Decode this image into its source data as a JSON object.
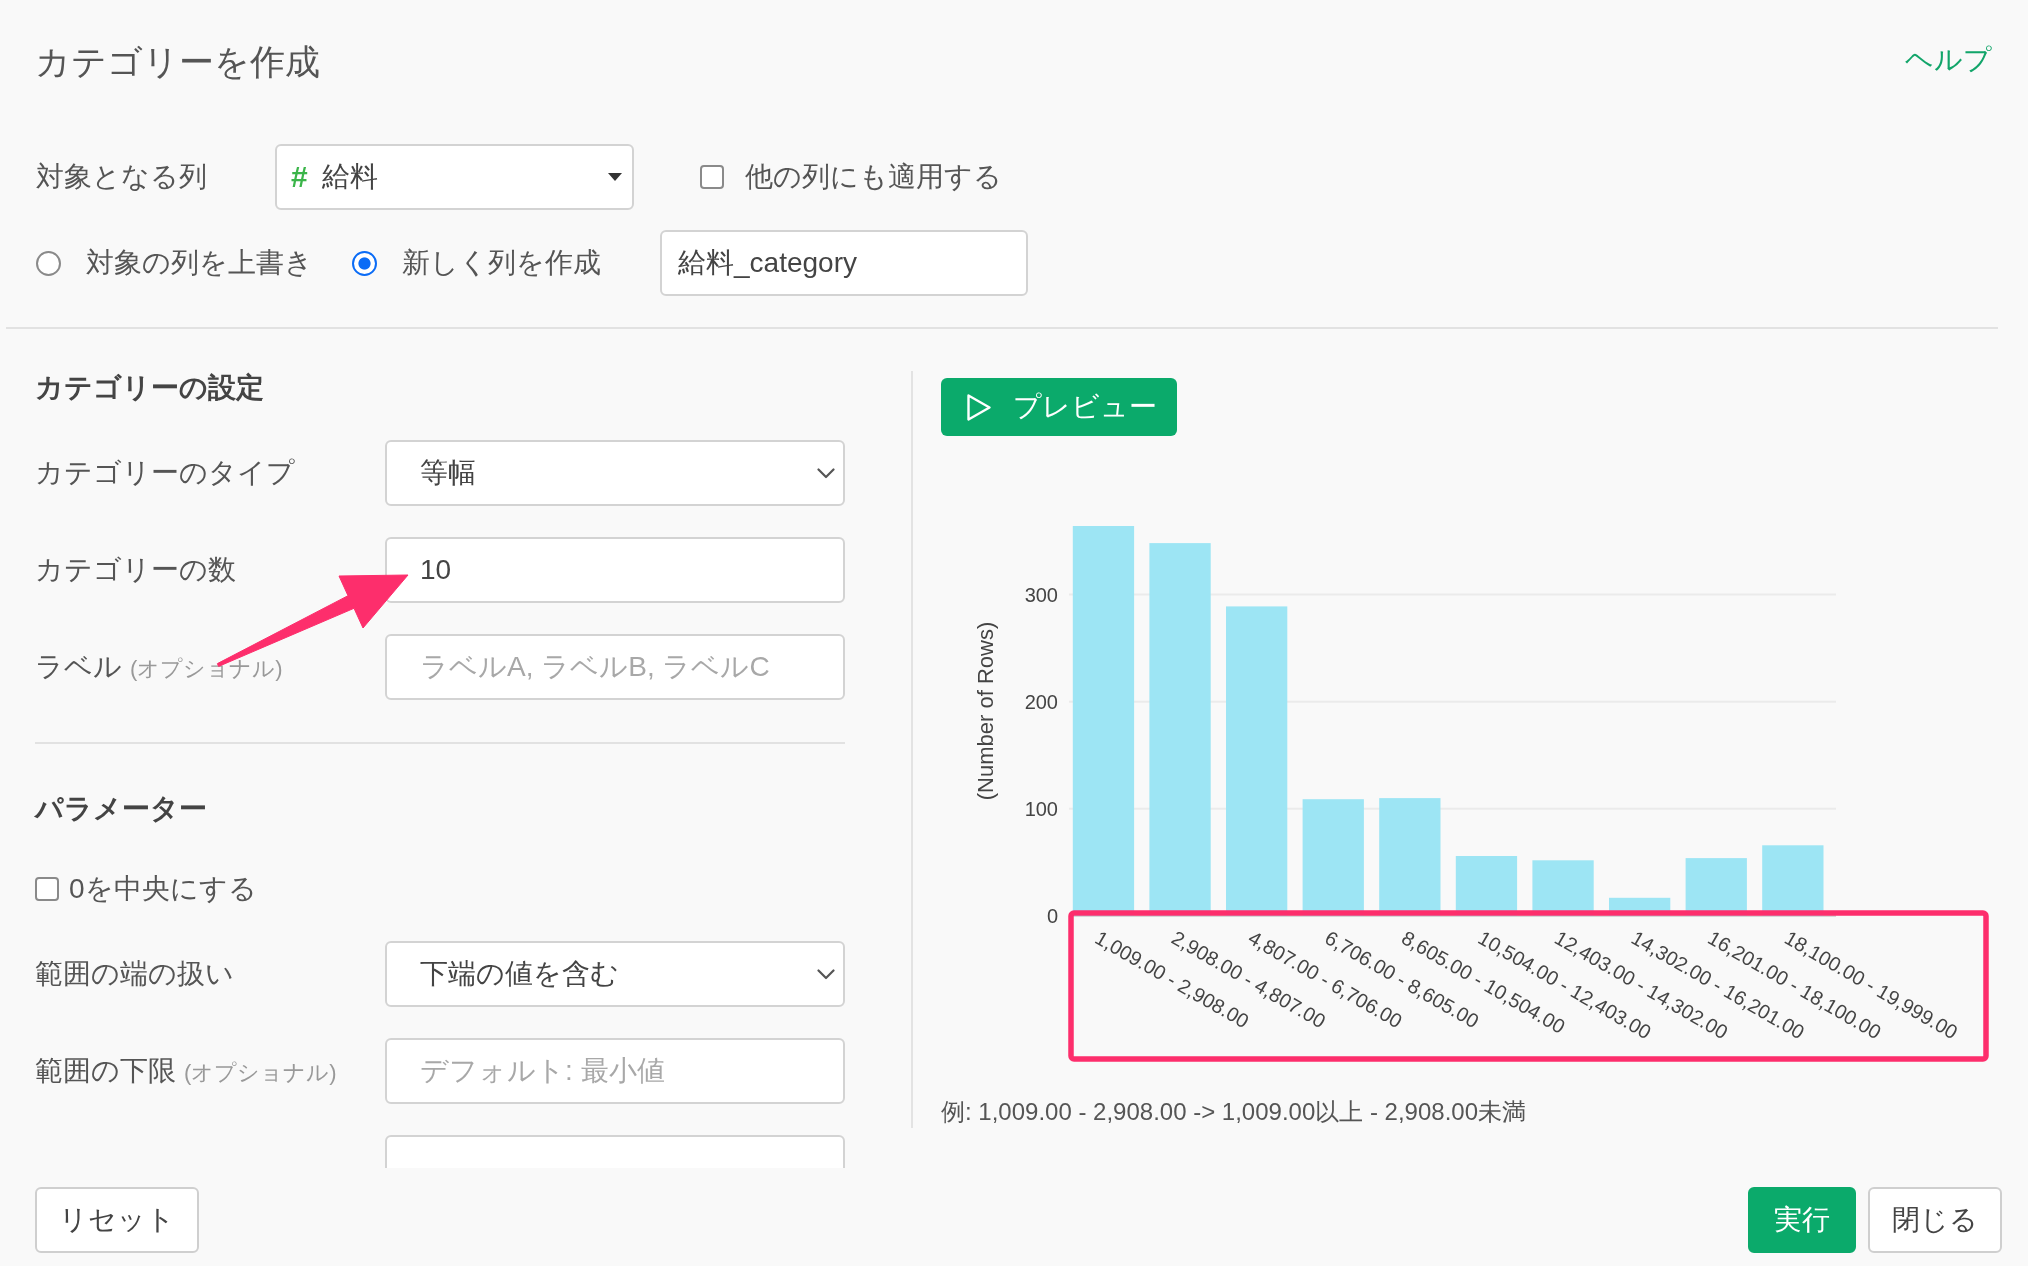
{
  "dialog": {
    "title": "カテゴリーを作成",
    "help_link": "ヘルプ"
  },
  "target_column": {
    "label": "対象となる列",
    "select": {
      "type_icon": "#",
      "value": "給料"
    },
    "apply_to_others": {
      "label": "他の列にも適用する",
      "checked": false
    }
  },
  "output_mode": {
    "options": [
      {
        "label": "対象の列を上書き",
        "selected": false
      },
      {
        "label": "新しく列を作成",
        "selected": true
      }
    ],
    "new_column_name": {
      "value": "給料_category"
    }
  },
  "category_settings": {
    "heading": "カテゴリーの設定",
    "fields": [
      {
        "kind": "select",
        "label": "カテゴリーのタイプ",
        "value": "等幅"
      },
      {
        "kind": "input",
        "label": "カテゴリーの数",
        "value": "10",
        "pointer_arrow": true
      },
      {
        "kind": "input",
        "label": "ラベル",
        "note": "(オプショナル)",
        "placeholder": "ラベルA, ラベルB, ラベルC"
      }
    ]
  },
  "parameters": {
    "heading": "パラメーター",
    "fields": [
      {
        "kind": "checkbox",
        "label": "0を中央にする",
        "checked": false
      },
      {
        "kind": "select",
        "label": "範囲の端の扱い",
        "value": "下端の値を含む"
      },
      {
        "kind": "input",
        "label": "範囲の下限",
        "note": "(オプショナル)",
        "placeholder": "デフォルト: 最小値"
      },
      {
        "kind": "input"
      }
    ]
  },
  "preview": {
    "button": "プレビュー",
    "chart_data": {
      "type": "bar",
      "ylabel": "(Number of Rows)",
      "categories": [
        "1,009.00 - 2,908.00",
        "2,908.00 - 4,807.00",
        "4,807.00 - 6,706.00",
        "6,706.00 - 8,605.00",
        "8,605.00 - 10,504.00",
        "10,504.00 - 12,403.00",
        "12,403.00 - 14,302.00",
        "14,302.00 - 16,201.00",
        "16,201.00 - 18,100.00",
        "18,100.00 - 19,999.00"
      ],
      "values": [
        364,
        348,
        289,
        109,
        110,
        56,
        52,
        17,
        54,
        66
      ],
      "ylim": [
        0,
        364
      ],
      "yticks": [
        0,
        100,
        200,
        300
      ],
      "grid": true
    },
    "x_labels_highlighted": true,
    "example": "例: 1,009.00 - 2,908.00 -> 1,009.00以上 - 2,908.00未満"
  },
  "footer": {
    "buttons": [
      {
        "label": "リセット",
        "kind": "default"
      },
      {
        "label": "実行",
        "kind": "primary"
      },
      {
        "label": "閉じる",
        "kind": "default"
      }
    ]
  }
}
